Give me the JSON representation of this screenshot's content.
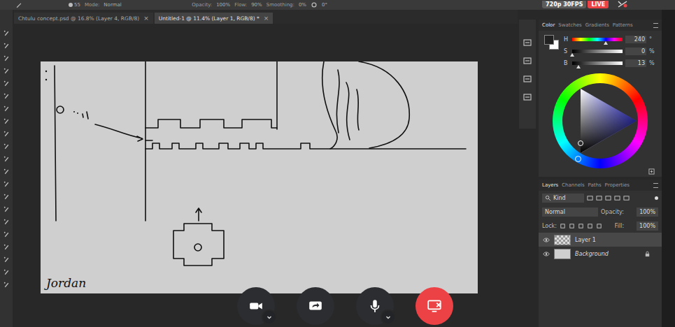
{
  "options_bar": {
    "brush_size": "55",
    "mode_label": "Mode:",
    "mode": "Normal",
    "opacity_label": "Opacity:",
    "opacity": "100%",
    "flow_label": "Flow:",
    "flow": "90%",
    "smoothing_label": "Smoothing:",
    "smoothing": "0%",
    "angle": "0°"
  },
  "stream": {
    "quality": "720p 30FPS",
    "live": "LIVE"
  },
  "tabs": [
    {
      "label": "Chtulu concept.psd @ 16.8% (Layer 4, RGB/8)",
      "close": "×",
      "selected": false
    },
    {
      "label": "Untitled-1 @ 11.4% (Layer 1, RGB/8) *",
      "close": "×",
      "selected": true
    }
  ],
  "canvas": {
    "signature": "Jordan"
  },
  "color_panel": {
    "tabs": [
      {
        "label": "Color",
        "selected": true
      },
      {
        "label": "Swatches",
        "selected": false
      },
      {
        "label": "Gradients",
        "selected": false
      },
      {
        "label": "Patterns",
        "selected": false
      }
    ],
    "foreground": "#212121",
    "background": "#ffffff",
    "channels": [
      {
        "name": "H",
        "kind": "hue",
        "value": "240",
        "unit": "°",
        "level": 0.667
      },
      {
        "name": "S",
        "kind": "ramp",
        "value": "0",
        "unit": "%",
        "level": 0
      },
      {
        "name": "B",
        "kind": "ramp",
        "value": "13",
        "unit": "%",
        "level": 0.13
      }
    ]
  },
  "layers_panel": {
    "tabs": [
      {
        "label": "Layers",
        "selected": true
      },
      {
        "label": "Channels",
        "selected": false
      },
      {
        "label": "Paths",
        "selected": false
      },
      {
        "label": "Properties",
        "selected": false
      }
    ],
    "filter": "Kind",
    "blend_mode": "Normal",
    "opacity_label": "Opacity:",
    "opacity": "100%",
    "lock_label": "Lock:",
    "fill_label": "Fill:",
    "fill": "100%",
    "layers": [
      {
        "name": "Layer 1",
        "kind": "pixel",
        "visible": true,
        "selected": true,
        "locked": false
      },
      {
        "name": "Background",
        "kind": "background",
        "visible": true,
        "selected": false,
        "locked": true
      }
    ]
  },
  "call_controls": [
    {
      "kind": "camera",
      "has_menu": true
    },
    {
      "kind": "share",
      "has_menu": false
    },
    {
      "kind": "mic",
      "has_menu": true
    },
    {
      "kind": "end",
      "has_menu": false
    }
  ]
}
